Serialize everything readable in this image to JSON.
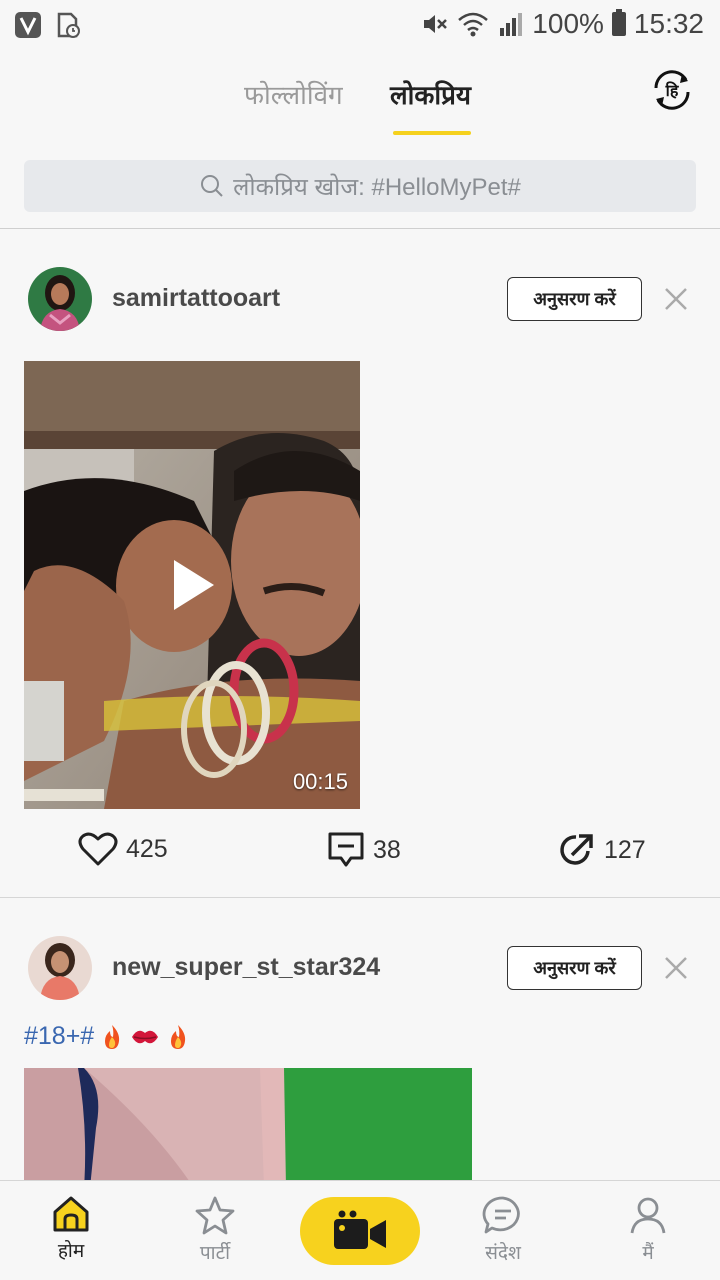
{
  "status_bar": {
    "battery": "100%",
    "time": "15:32"
  },
  "tabs": {
    "following": "फोल्लोविंग",
    "popular": "लोकप्रिय",
    "lang_glyph": "हि"
  },
  "search": {
    "placeholder": "लोकप्रिय खोज: #HelloMyPet#"
  },
  "posts": [
    {
      "username": "samirtattooart",
      "follow_label": "अनुसरण करें",
      "duration": "00:15",
      "likes": "425",
      "comments": "38",
      "shares": "127"
    },
    {
      "username": "new_super_st_star324",
      "follow_label": "अनुसरण करें",
      "caption": "#18+#"
    }
  ],
  "nav": {
    "home": "होम",
    "party": "पार्टी",
    "messages": "संदेश",
    "me": "मैं"
  },
  "colors": {
    "accent": "#f5d11e",
    "hashtag": "#3a67b0"
  }
}
